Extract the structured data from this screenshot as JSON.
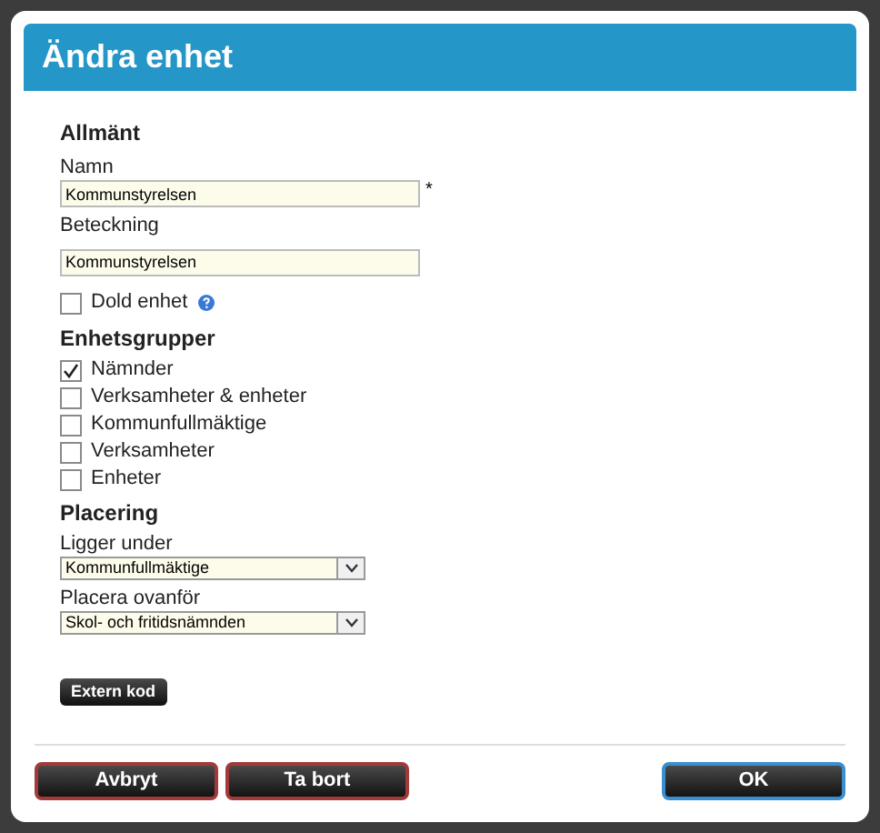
{
  "dialog": {
    "title": "Ändra enhet"
  },
  "general": {
    "heading": "Allmänt",
    "name": {
      "label": "Namn",
      "value": "Kommunstyrelsen",
      "required_mark": "*"
    },
    "designation": {
      "label": "Beteckning",
      "value": "Kommunstyrelsen"
    },
    "hidden": {
      "label": "Dold enhet",
      "checked": false
    }
  },
  "groups": {
    "heading": "Enhetsgrupper",
    "items": [
      {
        "label": "Nämnder",
        "checked": true
      },
      {
        "label": "Verksamheter & enheter",
        "checked": false
      },
      {
        "label": "Kommunfullmäktige",
        "checked": false
      },
      {
        "label": "Verksamheter",
        "checked": false
      },
      {
        "label": "Enheter",
        "checked": false
      }
    ]
  },
  "placement": {
    "heading": "Placering",
    "selects": [
      {
        "label": "Ligger under",
        "value": "Kommunfullmäktige"
      },
      {
        "label": "Placera ovanför",
        "value": "Skol- och fritidsnämnden"
      }
    ],
    "extern_button": "Extern kod"
  },
  "footer": {
    "buttons": [
      {
        "label": "Avbryt",
        "kind": "danger"
      },
      {
        "label": "Ta bort",
        "kind": "danger"
      },
      {
        "label": "OK",
        "kind": "primary"
      }
    ]
  }
}
